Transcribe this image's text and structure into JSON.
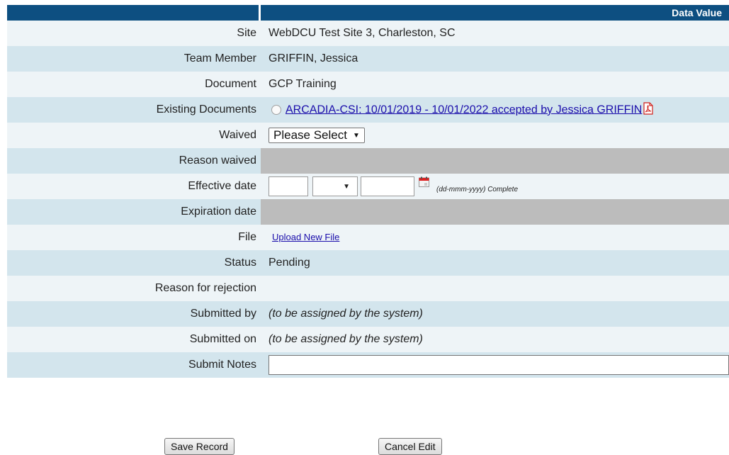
{
  "header": {
    "label_col": "",
    "value_col": "Data Value"
  },
  "rows": {
    "site": {
      "label": "Site",
      "value": "WebDCU Test Site 3, Charleston, SC"
    },
    "team_member": {
      "label": "Team Member",
      "value": "GRIFFIN, Jessica"
    },
    "document": {
      "label": "Document",
      "value": "GCP Training"
    },
    "existing_documents": {
      "label": "Existing Documents",
      "link": "ARCADIA-CSI: 10/01/2019 - 10/01/2022 accepted by Jessica GRIFFIN"
    },
    "waived": {
      "label": "Waived",
      "selected": "Please Select"
    },
    "reason_waived": {
      "label": "Reason waived"
    },
    "effective_date": {
      "label": "Effective date",
      "hint": "(dd-mmm-yyyy) Complete"
    },
    "expiration_date": {
      "label": "Expiration date"
    },
    "file": {
      "label": "File",
      "link": "Upload New File"
    },
    "status": {
      "label": "Status",
      "value": "Pending"
    },
    "reason_rejection": {
      "label": "Reason for rejection",
      "value": ""
    },
    "submitted_by": {
      "label": "Submitted by",
      "value": "(to be assigned by the system)"
    },
    "submitted_on": {
      "label": "Submitted on",
      "value": "(to be assigned by the system)"
    },
    "submit_notes": {
      "label": "Submit Notes",
      "value": ""
    }
  },
  "buttons": {
    "save": "Save Record",
    "cancel": "Cancel Edit"
  },
  "icons": {
    "radio": "radio-button-icon",
    "pdf": "pdf-icon",
    "calendar": "calendar-icon",
    "dropdown": "dropdown-arrow-icon"
  },
  "colors": {
    "header_bg": "#0d4f81",
    "row_light": "#eef4f7",
    "row_dark": "#d3e5ed",
    "disabled": "#bcbcbc",
    "link": "#1a0dab"
  }
}
